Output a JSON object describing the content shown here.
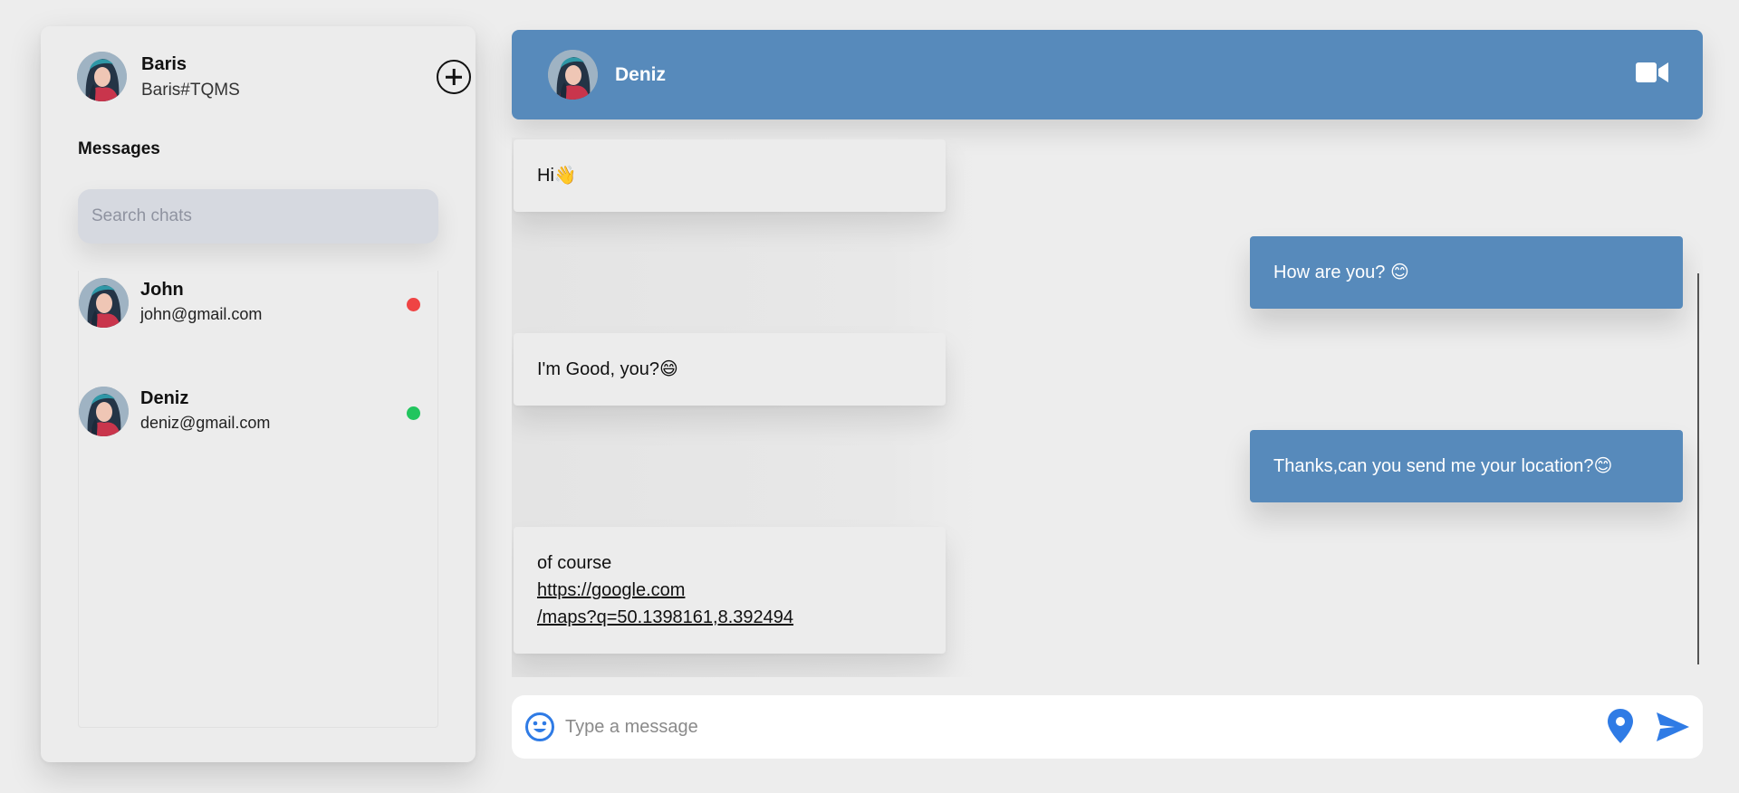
{
  "colors": {
    "accent": "#578abb",
    "online": "#22c55e",
    "offline": "#ef4444",
    "icon_blue": "#2f7be5"
  },
  "profile": {
    "name": "Baris",
    "tag": "Baris#TQMS"
  },
  "sidebar": {
    "section_title": "Messages",
    "search_placeholder": "Search chats",
    "chats": [
      {
        "name": "John",
        "email": "john@gmail.com",
        "status": "offline"
      },
      {
        "name": "Deniz",
        "email": "deniz@gmail.com",
        "status": "online"
      }
    ]
  },
  "header": {
    "contact_name": "Deniz",
    "video_icon": "video-camera-icon"
  },
  "messages": [
    {
      "direction": "in",
      "text": "Hi👋"
    },
    {
      "direction": "out",
      "text": "How are you? 😊"
    },
    {
      "direction": "in",
      "text": "I'm Good, you?😄"
    },
    {
      "direction": "out",
      "text": "Thanks,can you send me your location?😊"
    },
    {
      "direction": "in",
      "text": "of course",
      "link": "https://google.com/maps?q=50.1398161,8.392494",
      "link_line1": "https://google.com",
      "link_line2": "/maps?q=50.1398161,8.392494"
    }
  ],
  "composer": {
    "placeholder": "Type a message",
    "icons": [
      "emoji-icon",
      "location-pin-icon",
      "send-icon"
    ]
  }
}
